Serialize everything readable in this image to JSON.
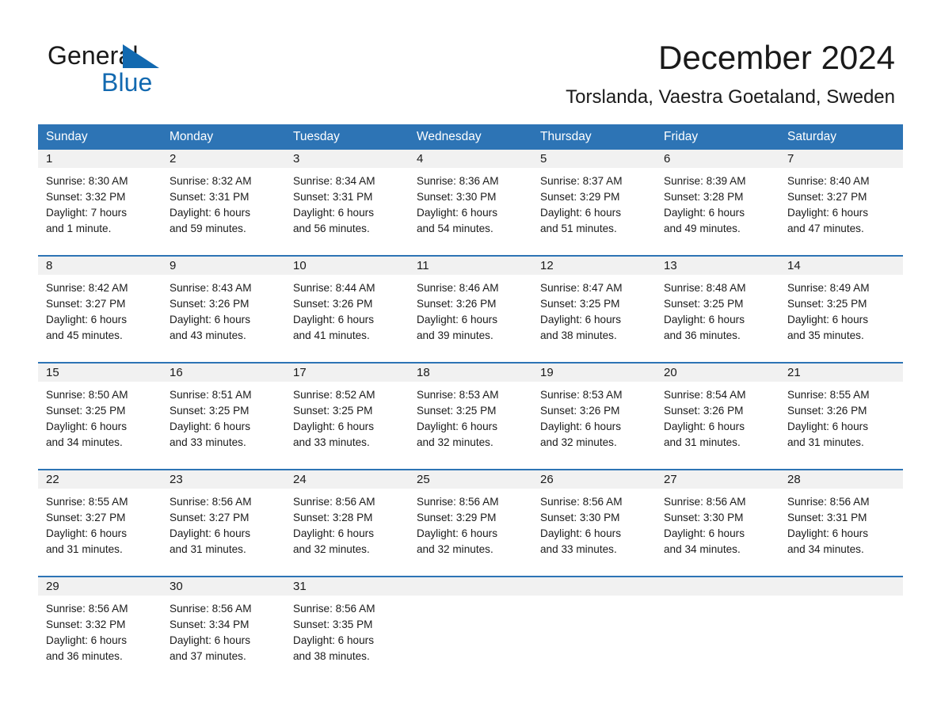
{
  "brand": {
    "name_part1": "General",
    "name_part2": "Blue",
    "accent_color": "#1269b0",
    "logo_icon": "triangle-flag-icon"
  },
  "header": {
    "month_title": "December 2024",
    "location": "Torslanda, Vaestra Goetaland, Sweden"
  },
  "theme": {
    "header_blue": "#2d74b5",
    "daynum_band_gray": "#f1f1f1",
    "text_color": "#1a1a1a"
  },
  "calendar": {
    "weekday_headers": [
      "Sunday",
      "Monday",
      "Tuesday",
      "Wednesday",
      "Thursday",
      "Friday",
      "Saturday"
    ],
    "weeks": [
      [
        {
          "day": "1",
          "sunrise": "Sunrise: 8:30 AM",
          "sunset": "Sunset: 3:32 PM",
          "daylight_line1": "Daylight: 7 hours",
          "daylight_line2": "and 1 minute."
        },
        {
          "day": "2",
          "sunrise": "Sunrise: 8:32 AM",
          "sunset": "Sunset: 3:31 PM",
          "daylight_line1": "Daylight: 6 hours",
          "daylight_line2": "and 59 minutes."
        },
        {
          "day": "3",
          "sunrise": "Sunrise: 8:34 AM",
          "sunset": "Sunset: 3:31 PM",
          "daylight_line1": "Daylight: 6 hours",
          "daylight_line2": "and 56 minutes."
        },
        {
          "day": "4",
          "sunrise": "Sunrise: 8:36 AM",
          "sunset": "Sunset: 3:30 PM",
          "daylight_line1": "Daylight: 6 hours",
          "daylight_line2": "and 54 minutes."
        },
        {
          "day": "5",
          "sunrise": "Sunrise: 8:37 AM",
          "sunset": "Sunset: 3:29 PM",
          "daylight_line1": "Daylight: 6 hours",
          "daylight_line2": "and 51 minutes."
        },
        {
          "day": "6",
          "sunrise": "Sunrise: 8:39 AM",
          "sunset": "Sunset: 3:28 PM",
          "daylight_line1": "Daylight: 6 hours",
          "daylight_line2": "and 49 minutes."
        },
        {
          "day": "7",
          "sunrise": "Sunrise: 8:40 AM",
          "sunset": "Sunset: 3:27 PM",
          "daylight_line1": "Daylight: 6 hours",
          "daylight_line2": "and 47 minutes."
        }
      ],
      [
        {
          "day": "8",
          "sunrise": "Sunrise: 8:42 AM",
          "sunset": "Sunset: 3:27 PM",
          "daylight_line1": "Daylight: 6 hours",
          "daylight_line2": "and 45 minutes."
        },
        {
          "day": "9",
          "sunrise": "Sunrise: 8:43 AM",
          "sunset": "Sunset: 3:26 PM",
          "daylight_line1": "Daylight: 6 hours",
          "daylight_line2": "and 43 minutes."
        },
        {
          "day": "10",
          "sunrise": "Sunrise: 8:44 AM",
          "sunset": "Sunset: 3:26 PM",
          "daylight_line1": "Daylight: 6 hours",
          "daylight_line2": "and 41 minutes."
        },
        {
          "day": "11",
          "sunrise": "Sunrise: 8:46 AM",
          "sunset": "Sunset: 3:26 PM",
          "daylight_line1": "Daylight: 6 hours",
          "daylight_line2": "and 39 minutes."
        },
        {
          "day": "12",
          "sunrise": "Sunrise: 8:47 AM",
          "sunset": "Sunset: 3:25 PM",
          "daylight_line1": "Daylight: 6 hours",
          "daylight_line2": "and 38 minutes."
        },
        {
          "day": "13",
          "sunrise": "Sunrise: 8:48 AM",
          "sunset": "Sunset: 3:25 PM",
          "daylight_line1": "Daylight: 6 hours",
          "daylight_line2": "and 36 minutes."
        },
        {
          "day": "14",
          "sunrise": "Sunrise: 8:49 AM",
          "sunset": "Sunset: 3:25 PM",
          "daylight_line1": "Daylight: 6 hours",
          "daylight_line2": "and 35 minutes."
        }
      ],
      [
        {
          "day": "15",
          "sunrise": "Sunrise: 8:50 AM",
          "sunset": "Sunset: 3:25 PM",
          "daylight_line1": "Daylight: 6 hours",
          "daylight_line2": "and 34 minutes."
        },
        {
          "day": "16",
          "sunrise": "Sunrise: 8:51 AM",
          "sunset": "Sunset: 3:25 PM",
          "daylight_line1": "Daylight: 6 hours",
          "daylight_line2": "and 33 minutes."
        },
        {
          "day": "17",
          "sunrise": "Sunrise: 8:52 AM",
          "sunset": "Sunset: 3:25 PM",
          "daylight_line1": "Daylight: 6 hours",
          "daylight_line2": "and 33 minutes."
        },
        {
          "day": "18",
          "sunrise": "Sunrise: 8:53 AM",
          "sunset": "Sunset: 3:25 PM",
          "daylight_line1": "Daylight: 6 hours",
          "daylight_line2": "and 32 minutes."
        },
        {
          "day": "19",
          "sunrise": "Sunrise: 8:53 AM",
          "sunset": "Sunset: 3:26 PM",
          "daylight_line1": "Daylight: 6 hours",
          "daylight_line2": "and 32 minutes."
        },
        {
          "day": "20",
          "sunrise": "Sunrise: 8:54 AM",
          "sunset": "Sunset: 3:26 PM",
          "daylight_line1": "Daylight: 6 hours",
          "daylight_line2": "and 31 minutes."
        },
        {
          "day": "21",
          "sunrise": "Sunrise: 8:55 AM",
          "sunset": "Sunset: 3:26 PM",
          "daylight_line1": "Daylight: 6 hours",
          "daylight_line2": "and 31 minutes."
        }
      ],
      [
        {
          "day": "22",
          "sunrise": "Sunrise: 8:55 AM",
          "sunset": "Sunset: 3:27 PM",
          "daylight_line1": "Daylight: 6 hours",
          "daylight_line2": "and 31 minutes."
        },
        {
          "day": "23",
          "sunrise": "Sunrise: 8:56 AM",
          "sunset": "Sunset: 3:27 PM",
          "daylight_line1": "Daylight: 6 hours",
          "daylight_line2": "and 31 minutes."
        },
        {
          "day": "24",
          "sunrise": "Sunrise: 8:56 AM",
          "sunset": "Sunset: 3:28 PM",
          "daylight_line1": "Daylight: 6 hours",
          "daylight_line2": "and 32 minutes."
        },
        {
          "day": "25",
          "sunrise": "Sunrise: 8:56 AM",
          "sunset": "Sunset: 3:29 PM",
          "daylight_line1": "Daylight: 6 hours",
          "daylight_line2": "and 32 minutes."
        },
        {
          "day": "26",
          "sunrise": "Sunrise: 8:56 AM",
          "sunset": "Sunset: 3:30 PM",
          "daylight_line1": "Daylight: 6 hours",
          "daylight_line2": "and 33 minutes."
        },
        {
          "day": "27",
          "sunrise": "Sunrise: 8:56 AM",
          "sunset": "Sunset: 3:30 PM",
          "daylight_line1": "Daylight: 6 hours",
          "daylight_line2": "and 34 minutes."
        },
        {
          "day": "28",
          "sunrise": "Sunrise: 8:56 AM",
          "sunset": "Sunset: 3:31 PM",
          "daylight_line1": "Daylight: 6 hours",
          "daylight_line2": "and 34 minutes."
        }
      ],
      [
        {
          "day": "29",
          "sunrise": "Sunrise: 8:56 AM",
          "sunset": "Sunset: 3:32 PM",
          "daylight_line1": "Daylight: 6 hours",
          "daylight_line2": "and 36 minutes."
        },
        {
          "day": "30",
          "sunrise": "Sunrise: 8:56 AM",
          "sunset": "Sunset: 3:34 PM",
          "daylight_line1": "Daylight: 6 hours",
          "daylight_line2": "and 37 minutes."
        },
        {
          "day": "31",
          "sunrise": "Sunrise: 8:56 AM",
          "sunset": "Sunset: 3:35 PM",
          "daylight_line1": "Daylight: 6 hours",
          "daylight_line2": "and 38 minutes."
        },
        {
          "day": "",
          "sunrise": "",
          "sunset": "",
          "daylight_line1": "",
          "daylight_line2": ""
        },
        {
          "day": "",
          "sunrise": "",
          "sunset": "",
          "daylight_line1": "",
          "daylight_line2": ""
        },
        {
          "day": "",
          "sunrise": "",
          "sunset": "",
          "daylight_line1": "",
          "daylight_line2": ""
        },
        {
          "day": "",
          "sunrise": "",
          "sunset": "",
          "daylight_line1": "",
          "daylight_line2": ""
        }
      ]
    ]
  }
}
